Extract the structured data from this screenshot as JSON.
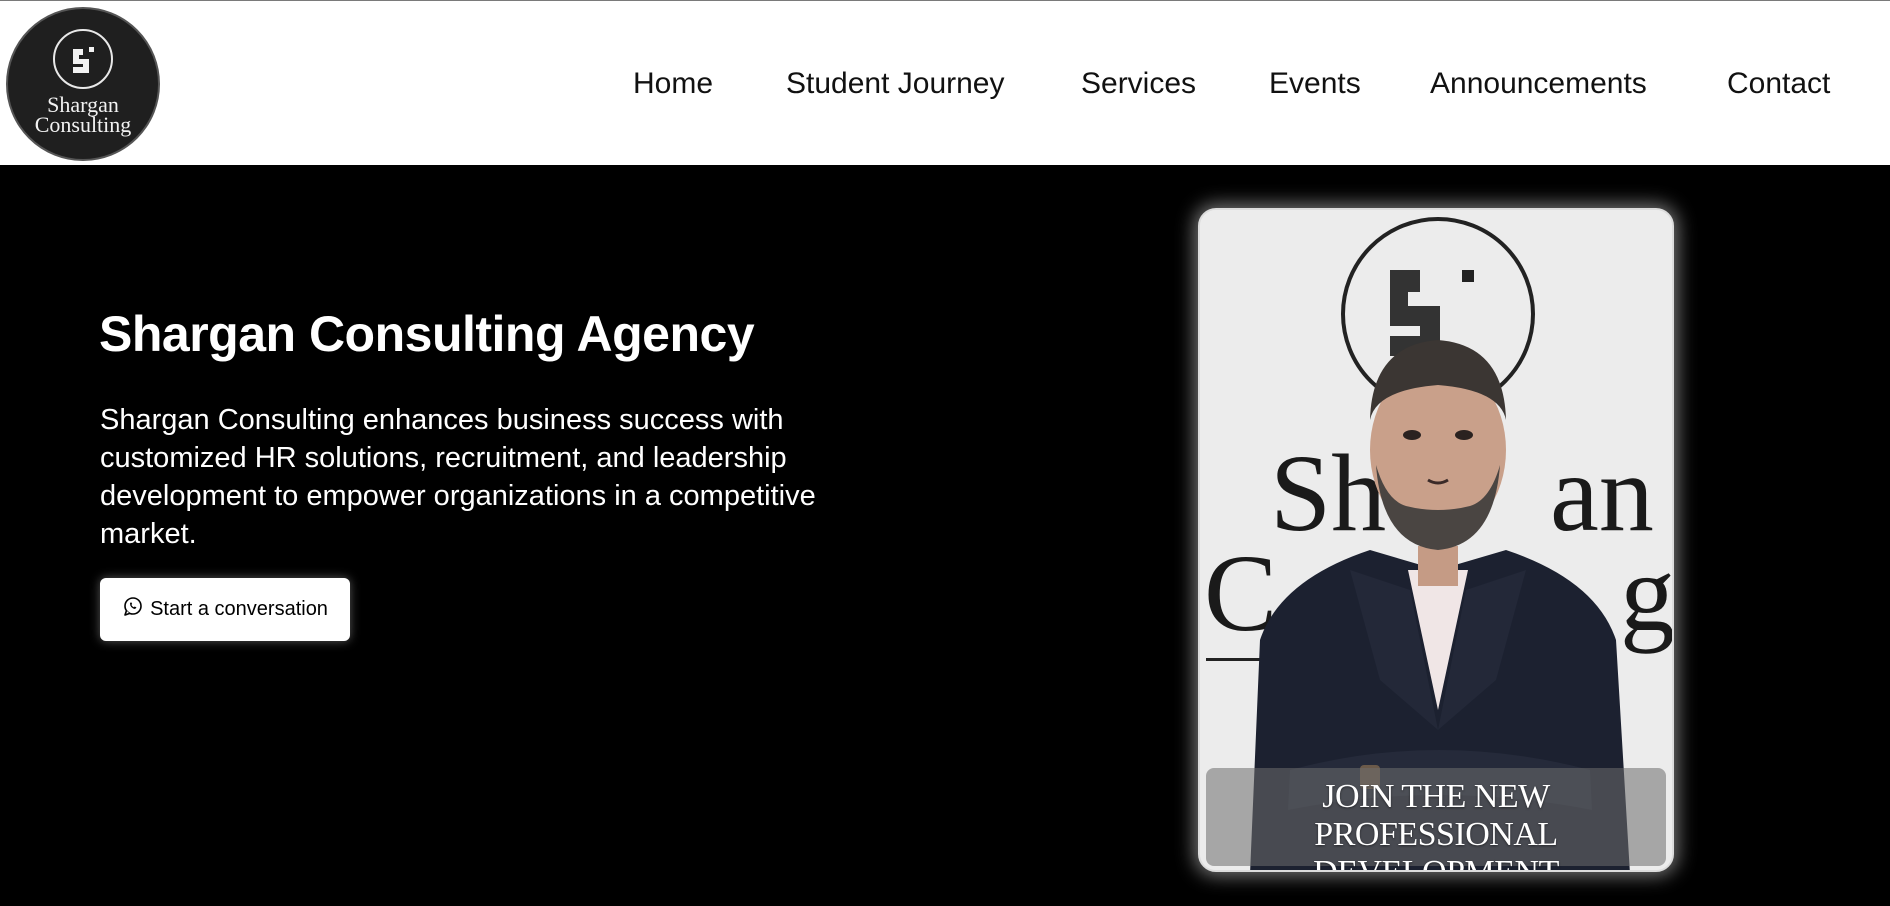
{
  "brand": {
    "logo_line1": "Shargan",
    "logo_line2": "Consulting"
  },
  "nav": {
    "items": [
      {
        "label": "Home"
      },
      {
        "label": "Student Journey"
      },
      {
        "label": "Services"
      },
      {
        "label": "Events"
      },
      {
        "label": "Announcements"
      },
      {
        "label": "Contact"
      }
    ]
  },
  "hero": {
    "title": "Shargan Consulting Agency",
    "description": "Shargan Consulting enhances business success with customized HR solutions, recruitment, and leadership development to empower organizations in a competitive market.",
    "cta_label": "Start a conversation",
    "cta_icon": "whatsapp-icon"
  },
  "promo": {
    "caption_line1": "JOIN THE NEW PROFESSIONAL",
    "caption_line2": "DEVELOPMENT COMMUNITY",
    "wall_sign": "Shargan Consulting"
  },
  "colors": {
    "header_bg": "#ffffff",
    "hero_bg": "#000000",
    "text_dark": "#111111",
    "text_light": "#ffffff"
  }
}
